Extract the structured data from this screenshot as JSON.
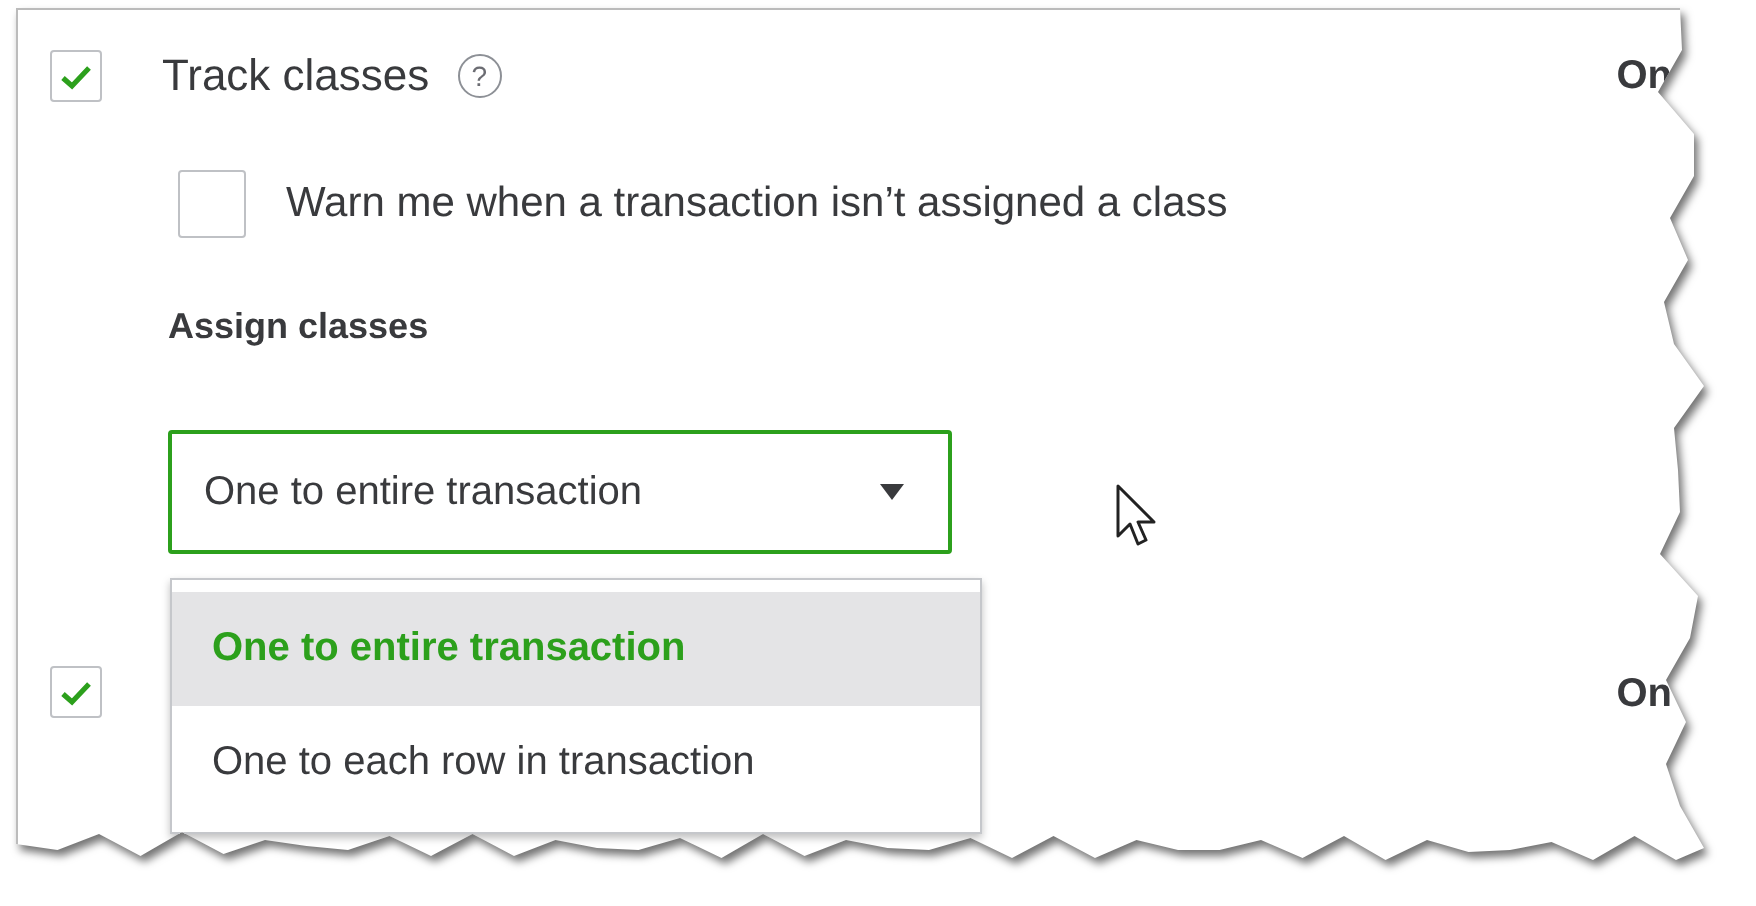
{
  "track_classes": {
    "label": "Track classes",
    "checked": true,
    "help_icon": "?",
    "status": "On"
  },
  "warn": {
    "label": "Warn me when a transaction isn’t assigned a class",
    "checked": false
  },
  "assign_classes": {
    "label": "Assign classes",
    "value": "One to entire transaction",
    "expanded": true,
    "options": [
      {
        "label": "One to entire transaction",
        "selected": true
      },
      {
        "label": "One to each row in transaction",
        "selected": false
      }
    ]
  },
  "second_setting": {
    "checked": true,
    "status": "On"
  }
}
